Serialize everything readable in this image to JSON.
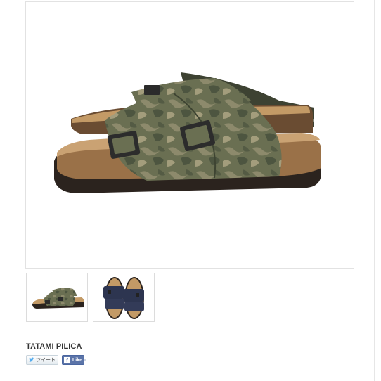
{
  "product": {
    "brand_name": "TATAMI PILICA"
  },
  "share": {
    "tweet_label": "ツイート",
    "like_label": "Like",
    "fb_letter": "f"
  },
  "images": {
    "main": {
      "icon": "camo-sandal-side-view"
    },
    "thumbnails": [
      {
        "icon": "camo-sandal-thumbnail"
      },
      {
        "icon": "navy-sandal-thumbnail"
      }
    ]
  },
  "colors": {
    "camo": "#6b6e4f",
    "footbed": "#b88f5e",
    "sole": "#2a2320",
    "navy": "#2d3550",
    "facebook": "#5b74a8",
    "twitter": "#55acee"
  }
}
